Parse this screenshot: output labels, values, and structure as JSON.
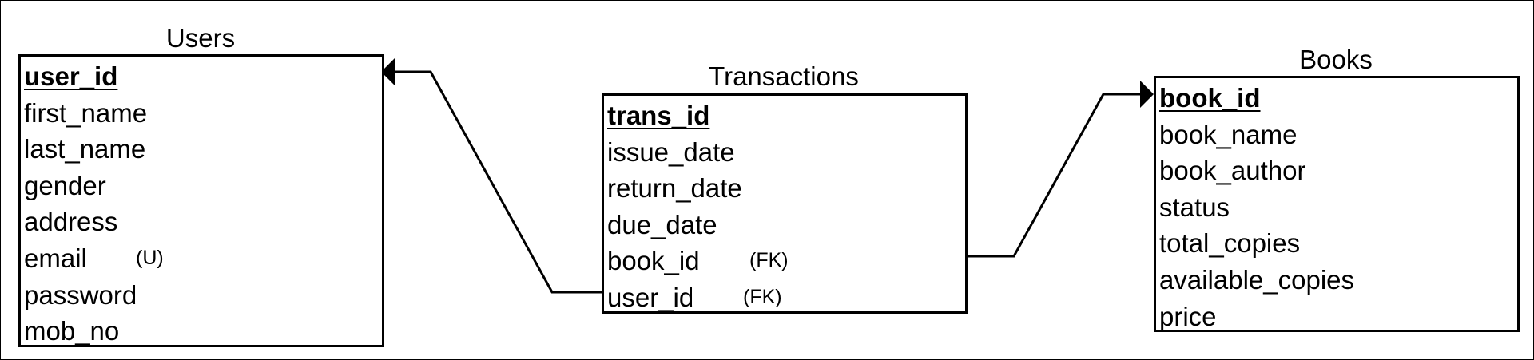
{
  "entities": {
    "users": {
      "title": "Users",
      "fields": [
        {
          "name": "user_id",
          "pk": true
        },
        {
          "name": "first_name"
        },
        {
          "name": "last_name"
        },
        {
          "name": "gender"
        },
        {
          "name": "address"
        },
        {
          "name": "email",
          "tag": "(U)"
        },
        {
          "name": "password"
        },
        {
          "name": "mob_no"
        }
      ]
    },
    "transactions": {
      "title": "Transactions",
      "fields": [
        {
          "name": "trans_id",
          "pk": true
        },
        {
          "name": "issue_date"
        },
        {
          "name": "return_date"
        },
        {
          "name": "due_date"
        },
        {
          "name": "book_id",
          "tag": "(FK)"
        },
        {
          "name": "user_id",
          "tag": "(FK)"
        }
      ]
    },
    "books": {
      "title": "Books",
      "fields": [
        {
          "name": "book_id",
          "pk": true
        },
        {
          "name": "book_name"
        },
        {
          "name": "book_author"
        },
        {
          "name": "status"
        },
        {
          "name": "total_copies"
        },
        {
          "name": "available_copies"
        },
        {
          "name": "price"
        }
      ]
    }
  },
  "relationships": [
    {
      "from": "Transactions.user_id",
      "to": "Users.user_id"
    },
    {
      "from": "Transactions.book_id",
      "to": "Books.book_id"
    }
  ]
}
